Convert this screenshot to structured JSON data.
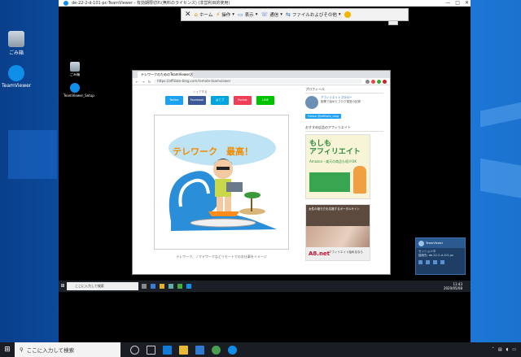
{
  "remote_window": {
    "title": "de-22-2-d-101-pc-TeamViewer - 有効期限切れ(無料のライセンス) (非営利目的使用)",
    "controls": [
      "—",
      "□",
      "✕"
    ]
  },
  "tv_toolbar": {
    "items": [
      {
        "label": "ホーム",
        "icon": "home-icon"
      },
      {
        "label": "操作",
        "icon": "lightning-icon"
      },
      {
        "label": "表示",
        "icon": "monitor-icon"
      },
      {
        "label": "通信",
        "icon": "chat-icon"
      },
      {
        "label": "ファイルおよびその他",
        "icon": "files-icon"
      }
    ],
    "close_glyph": "✕"
  },
  "local_desktop_icons": [
    {
      "label": "ごみ箱",
      "icon": "recycle-bin-icon"
    },
    {
      "label": "TeamViewer",
      "icon": "teamviewer-icon"
    }
  ],
  "remote_desktop_icons": [
    {
      "label": "ごみ箱",
      "icon": "recycle-bin-icon"
    },
    {
      "label": "TeamViewer_Setup",
      "icon": "teamviewer-icon"
    }
  ],
  "remote_browser": {
    "tab_title": "テレワークのためのTeamViewer活用法",
    "url": "https://affiliate-blog.com/remote-teamviewer",
    "share_label": "シェアする",
    "share_buttons": [
      {
        "label": "Twitter",
        "color": "#1da1f2"
      },
      {
        "label": "Facebook",
        "color": "#3b5998"
      },
      {
        "label": "はてブ",
        "color": "#00a4de"
      },
      {
        "label": "Pocket",
        "color": "#ef3f56"
      },
      {
        "label": "LINE",
        "color": "#00c300"
      }
    ],
    "illustration_text": "テレワーク　最高！",
    "caption": "テレワーク、ノマドワークなどリモートでのお仕事をイメージ",
    "sidebar": {
      "profile_heading": "プロフィール",
      "profile_name": "アフィリエイトブロガー",
      "profile_desc": "副業で始めたブログ運営の記録",
      "follow_label": "Follow @affiliate_blog",
      "ads_heading": "おすすめ広告のアフィリエイト",
      "ad1_title": "もしも\nアフィリエイト",
      "ad1_sub": "Amazon・楽天の商品も紹介OK",
      "ad2_text": "女性の働き方を応援するポータルサイト",
      "ad2_logo": "A8.net",
      "ad2_sub": "アフィリエイト始めるなら"
    }
  },
  "remote_taskbar": {
    "search": "ここに入力して検索",
    "clock_time": "11:43",
    "clock_date": "2020/05/08"
  },
  "tv_popup": {
    "title": "TeamViewer",
    "subtitle": "セッション中",
    "line": "接続先: de-22-2-d-101-pc"
  },
  "taskbar": {
    "search_placeholder": "ここに入力して検索"
  }
}
